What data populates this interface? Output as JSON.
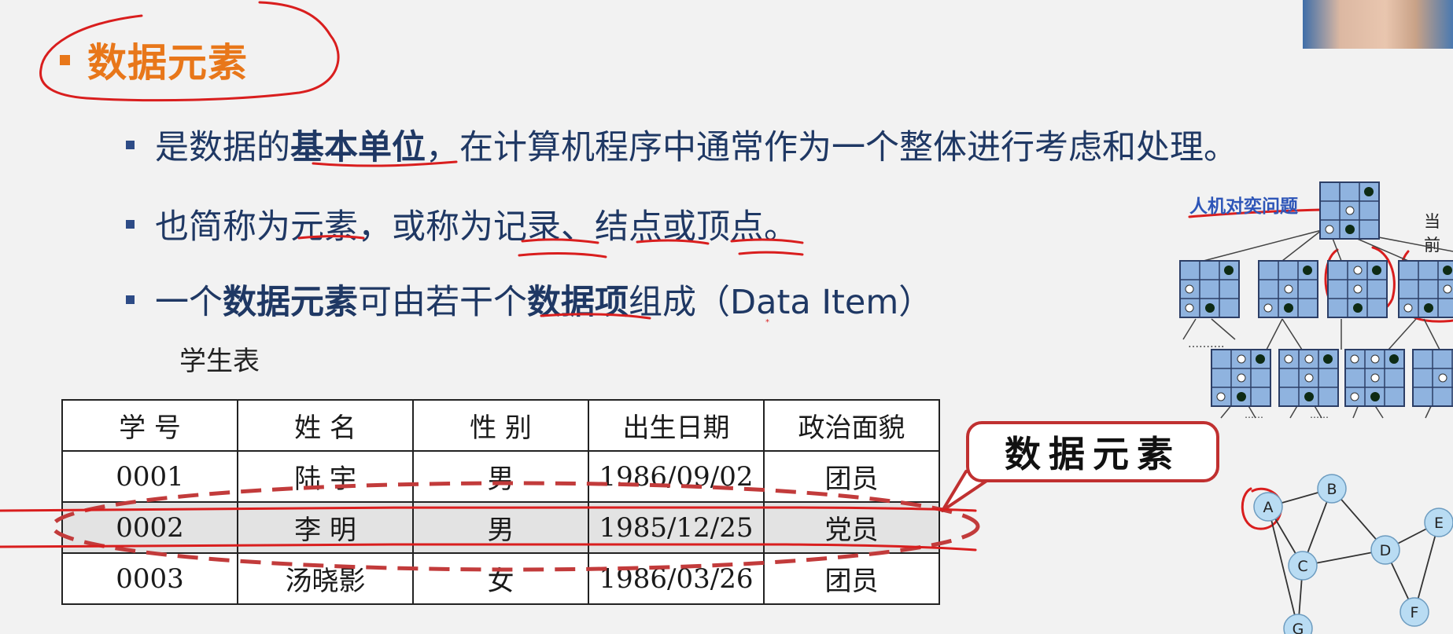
{
  "slide": {
    "title": "数据元素",
    "bullets": [
      {
        "parts": [
          {
            "text": "是数据的",
            "bold": false
          },
          {
            "text": "基本单位",
            "bold": true
          },
          {
            "text": "，在计算机程序中通常作为一个整体进行考虑和处理。",
            "bold": false
          }
        ]
      },
      {
        "parts": [
          {
            "text": "也简称为元素，或称为记录、结点或顶点。",
            "bold": false
          }
        ]
      },
      {
        "parts": [
          {
            "text": "一个",
            "bold": false
          },
          {
            "text": "数据元素",
            "bold": true
          },
          {
            "text": "可由若干个",
            "bold": false
          },
          {
            "text": "数据项",
            "bold": true
          },
          {
            "text": "组成（Data Item）",
            "bold": false
          }
        ]
      }
    ]
  },
  "table": {
    "caption": "学生表",
    "headers": [
      "学  号",
      "姓  名",
      "性  别",
      "出生日期",
      "政治面貌"
    ],
    "rows": [
      [
        "0001",
        "陆  宇",
        "男",
        "1986/09/02",
        "团员"
      ],
      [
        "0002",
        "李  明",
        "男",
        "1985/12/25",
        "党员"
      ],
      [
        "0003",
        "汤晓影",
        "女",
        "1986/03/26",
        "团员"
      ]
    ],
    "highlighted_row": 1
  },
  "callout": {
    "text": "数据元素"
  },
  "game_tree": {
    "label": "人机对奕问题",
    "label_2": "当前",
    "dots_1": "……….",
    "dots_2": "……",
    "dots_3": "……"
  },
  "graph": {
    "nodes": [
      "A",
      "B",
      "C",
      "D",
      "E",
      "F",
      "G"
    ]
  },
  "colors": {
    "title": "#e8771a",
    "bullet_text": "#1f3864",
    "annotation": "#d91e1e",
    "node_fill": "#b9dcf3",
    "board_fill": "#8fb3df"
  }
}
